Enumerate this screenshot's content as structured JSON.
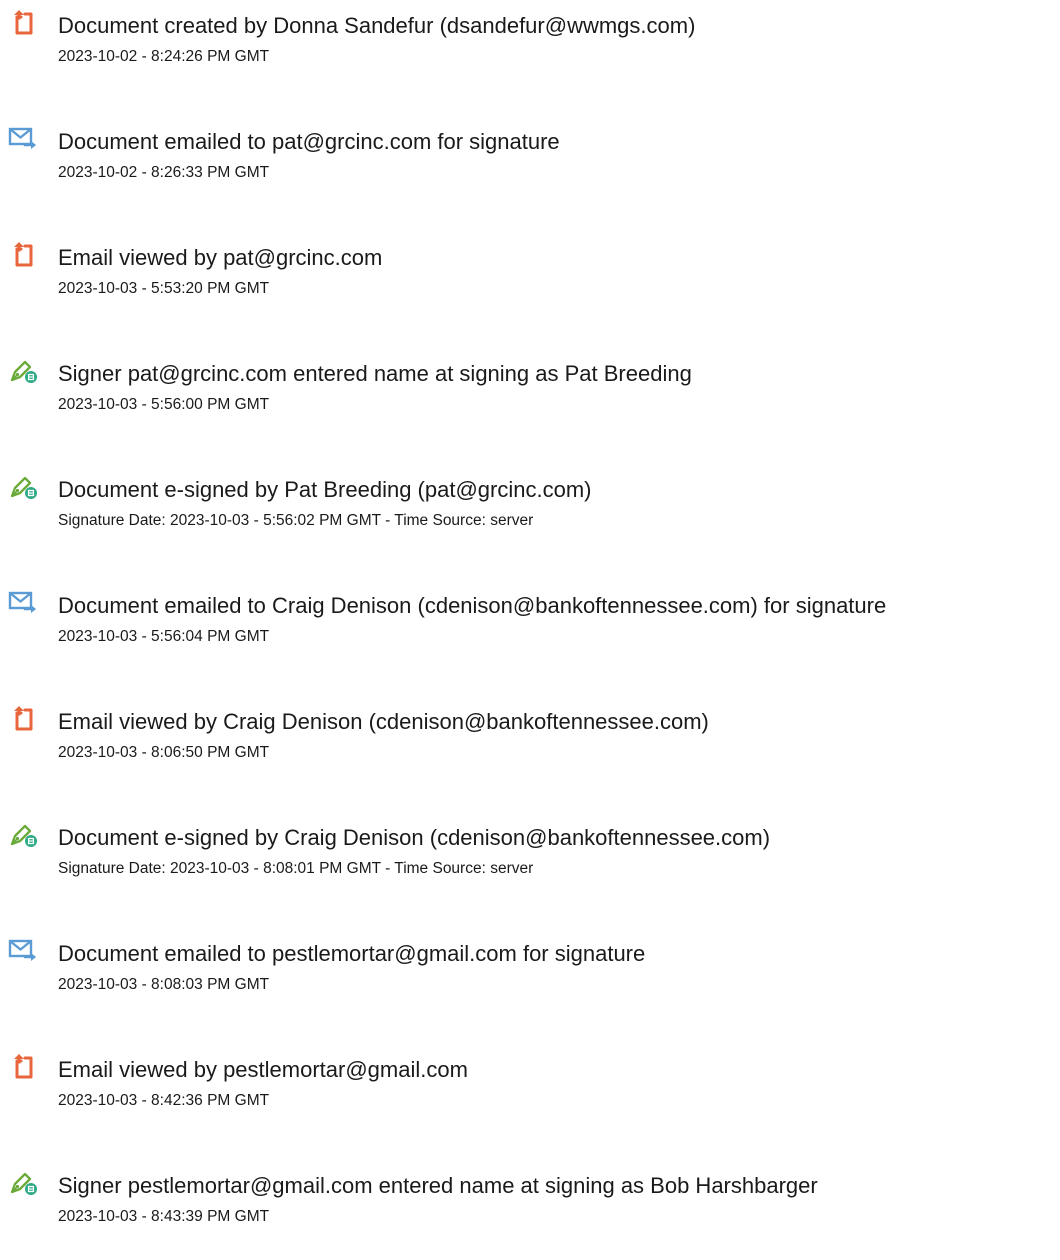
{
  "events": [
    {
      "icon": "document-icon",
      "title": "Document created by Donna Sandefur (dsandefur@wwmgs.com)",
      "date": "2023-10-02 - 8:24:26 PM GMT"
    },
    {
      "icon": "email-send-icon",
      "title": "Document emailed to pat@grcinc.com for signature",
      "date": "2023-10-02 - 8:26:33 PM GMT"
    },
    {
      "icon": "document-icon",
      "title": "Email viewed by pat@grcinc.com",
      "date": "2023-10-03 - 5:53:20 PM GMT"
    },
    {
      "icon": "pen-sign-icon",
      "title": "Signer pat@grcinc.com entered name at signing as Pat Breeding",
      "date": "2023-10-03 - 5:56:00 PM GMT"
    },
    {
      "icon": "pen-sign-icon",
      "title": "Document e-signed by Pat Breeding (pat@grcinc.com)",
      "date": "Signature Date: 2023-10-03 - 5:56:02 PM GMT - Time Source: server"
    },
    {
      "icon": "email-send-icon",
      "title": "Document emailed to Craig Denison (cdenison@bankoftennessee.com) for signature",
      "date": "2023-10-03 - 5:56:04 PM GMT"
    },
    {
      "icon": "document-icon",
      "title": "Email viewed by Craig Denison (cdenison@bankoftennessee.com)",
      "date": "2023-10-03 - 8:06:50 PM GMT"
    },
    {
      "icon": "pen-sign-icon",
      "title": "Document e-signed by Craig Denison (cdenison@bankoftennessee.com)",
      "date": "Signature Date: 2023-10-03 - 8:08:01 PM GMT - Time Source: server"
    },
    {
      "icon": "email-send-icon",
      "title": "Document emailed to pestlemortar@gmail.com for signature",
      "date": "2023-10-03 - 8:08:03 PM GMT"
    },
    {
      "icon": "document-icon",
      "title": "Email viewed by pestlemortar@gmail.com",
      "date": "2023-10-03 - 8:42:36 PM GMT"
    },
    {
      "icon": "pen-sign-icon",
      "title": "Signer pestlemortar@gmail.com entered name at signing as Bob Harshbarger",
      "date": "2023-10-03 - 8:43:39 PM GMT"
    }
  ],
  "colors": {
    "document_icon": "#e8663c",
    "email_icon": "#5b9bd5",
    "pen_icon": "#6aaa3a",
    "pen_badge": "#2eaa86"
  }
}
